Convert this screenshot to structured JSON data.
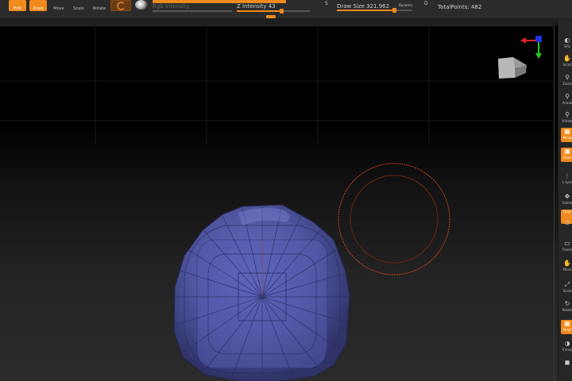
{
  "toolbar": {
    "edit_label": "Edit",
    "draw_label": "Draw",
    "move_label": "Move",
    "scale_label": "Scale",
    "rotate_label": "Rotate",
    "rgb_intensity_label": "Rgb Intensity",
    "z_intensity_label": "Z Intensity 43",
    "z_intensity_value": 43,
    "draw_size_label": "Draw Size 321.962",
    "draw_size_value": 321.962,
    "dynamic_label": "Dynamic",
    "s_badge": "S",
    "d_badge": "D",
    "total_points_label": "TotalPoints: 482",
    "total_points_value": 482,
    "accent_color": "#f08a1c"
  },
  "tray": {
    "items": [
      {
        "label": "SPix",
        "icon": "spix-icon",
        "glyph": "◐"
      },
      {
        "label": "Scroll",
        "icon": "scroll-hand-icon",
        "glyph": "✋"
      },
      {
        "label": "Zoom",
        "icon": "zoom-icon",
        "glyph": "⚲"
      },
      {
        "label": "Actual",
        "icon": "actual-icon",
        "glyph": "⚲"
      },
      {
        "label": "AAHalf",
        "icon": "aahalf-icon",
        "glyph": "⚲"
      },
      {
        "label": "Persp",
        "icon": "persp-icon",
        "glyph": "▦",
        "active": true
      },
      {
        "label": "Floor",
        "icon": "floor-icon",
        "glyph": "▦",
        "active": true
      },
      {
        "label": "L.Sym",
        "icon": "lsym-icon",
        "glyph": "⋮"
      },
      {
        "label": "Gizmo",
        "icon": "gizmo-icon",
        "glyph": "✥"
      },
      {
        "label": "Qxyz",
        "icon": "qxyz-icon",
        "glyph": "",
        "active": true
      },
      {
        "label": "",
        "icon": "axis-icon",
        "glyph": "⊙"
      },
      {
        "label": "Frame",
        "icon": "frame-icon",
        "glyph": "▭"
      },
      {
        "label": "Move",
        "icon": "move-icon",
        "glyph": "✋"
      },
      {
        "label": "Scale",
        "icon": "scale-icon",
        "glyph": "⤢"
      },
      {
        "label": "Rotate",
        "icon": "rotate-icon",
        "glyph": "↻"
      },
      {
        "label": "PolyF",
        "icon": "polyframe-icon",
        "glyph": "▦",
        "active": true
      },
      {
        "label": "Transp",
        "icon": "transp-icon",
        "glyph": "◑"
      },
      {
        "label": "",
        "icon": "ghost-icon",
        "glyph": "◼"
      }
    ]
  }
}
